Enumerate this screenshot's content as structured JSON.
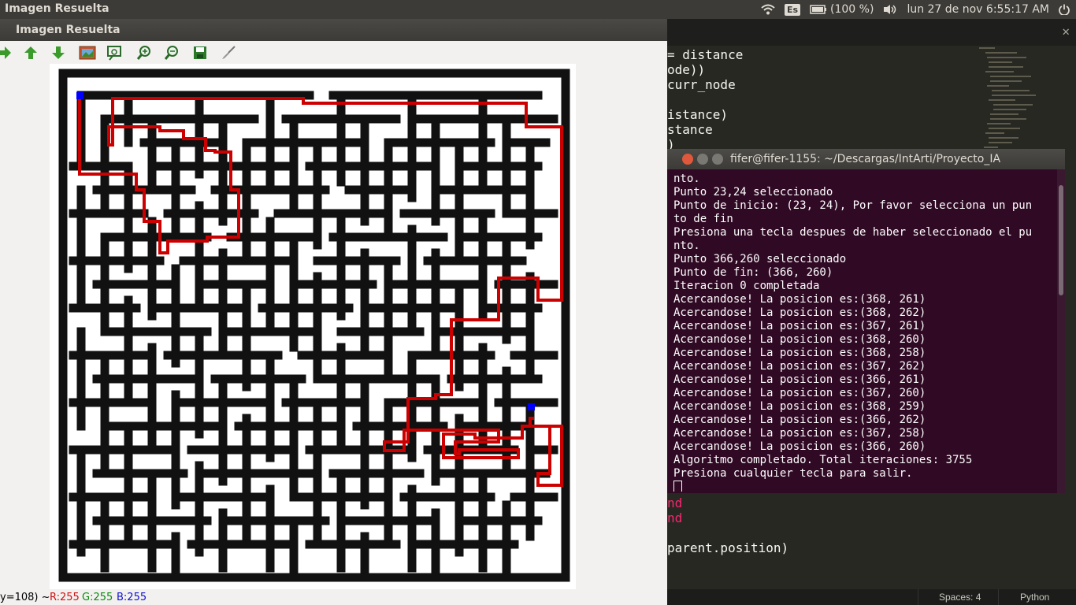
{
  "top_panel": {
    "app_title": "Imagen Resuelta",
    "keyboard": "Es",
    "battery": "(100 %)",
    "datetime": "lun 27 de nov  6:55:17 AM"
  },
  "viewer": {
    "title": "Imagen Resuelta",
    "status": {
      "coords": "y=108) ~",
      "r": "R:255",
      "g": "G:255",
      "b": "B:255"
    }
  },
  "editor": {
    "lines": [
      "= distance",
      "ode))",
      "curr_node",
      "",
      "istance)",
      "stance",
      ")"
    ],
    "lines_below": [
      "r",
      "nd",
      "nd",
      "",
      "parent.position)"
    ],
    "status": {
      "spaces": "Spaces: 4",
      "language": "Python"
    }
  },
  "terminal": {
    "title": "fifer@fifer-1155: ~/Descargas/IntArti/Proyecto_IA",
    "lines": [
      "nto.",
      "Punto 23,24 seleccionado",
      "Punto de inicio: (23, 24), Por favor selecciona un pun",
      "to de fin",
      "Presiona una tecla despues de haber seleccionado el pu",
      "nto.",
      "Punto 366,260 seleccionado",
      "Punto de fin: (366, 260)",
      "Iteracion 0 completada",
      "Acercandose! La posicion es:(368, 261)",
      "Acercandose! La posicion es:(368, 262)",
      "Acercandose! La posicion es:(367, 261)",
      "Acercandose! La posicion es:(368, 260)",
      "Acercandose! La posicion es:(368, 258)",
      "Acercandose! La posicion es:(367, 262)",
      "Acercandose! La posicion es:(366, 261)",
      "Acercandose! La posicion es:(367, 260)",
      "Acercandose! La posicion es:(368, 259)",
      "Acercandose! La posicion es:(366, 262)",
      "Acercandose! La posicion es:(367, 258)",
      "Acercandose! La posicion es:(366, 260)",
      "Algoritmo completado. Total iteraciones: 3755",
      "Presiona cualquier tecla para salir."
    ]
  },
  "colors": {
    "path": "#cc0000",
    "marker": "#0000ff",
    "terminal_bg": "#300a24",
    "editor_bg": "#272822"
  }
}
